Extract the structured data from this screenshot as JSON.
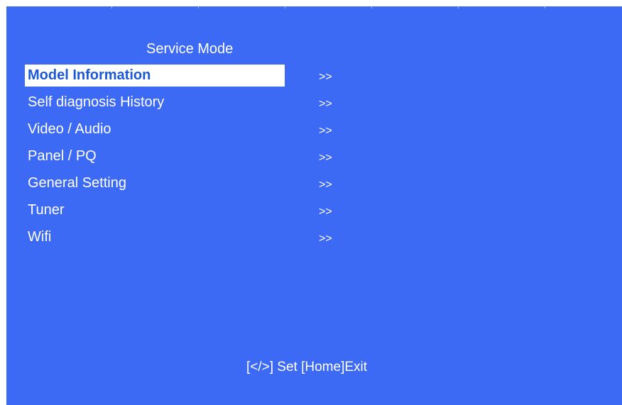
{
  "title": "Service Mode",
  "menu": {
    "items": [
      {
        "label": "Model Information",
        "arrow": ">>",
        "selected": true
      },
      {
        "label": "Self diagnosis History",
        "arrow": ">>",
        "selected": false
      },
      {
        "label": "Video / Audio",
        "arrow": ">>",
        "selected": false
      },
      {
        "label": "Panel / PQ",
        "arrow": ">>",
        "selected": false
      },
      {
        "label": "General Setting",
        "arrow": ">>",
        "selected": false
      },
      {
        "label": "Tuner",
        "arrow": ">>",
        "selected": false
      },
      {
        "label": "Wifi",
        "arrow": ">>",
        "selected": false
      }
    ]
  },
  "footer": {
    "hint": "[</>] Set [Home]Exit"
  },
  "colors": {
    "background": "#3d6af5",
    "selected_background": "#ffffff",
    "selected_text": "#1d58d8",
    "text": "#ffffff"
  }
}
